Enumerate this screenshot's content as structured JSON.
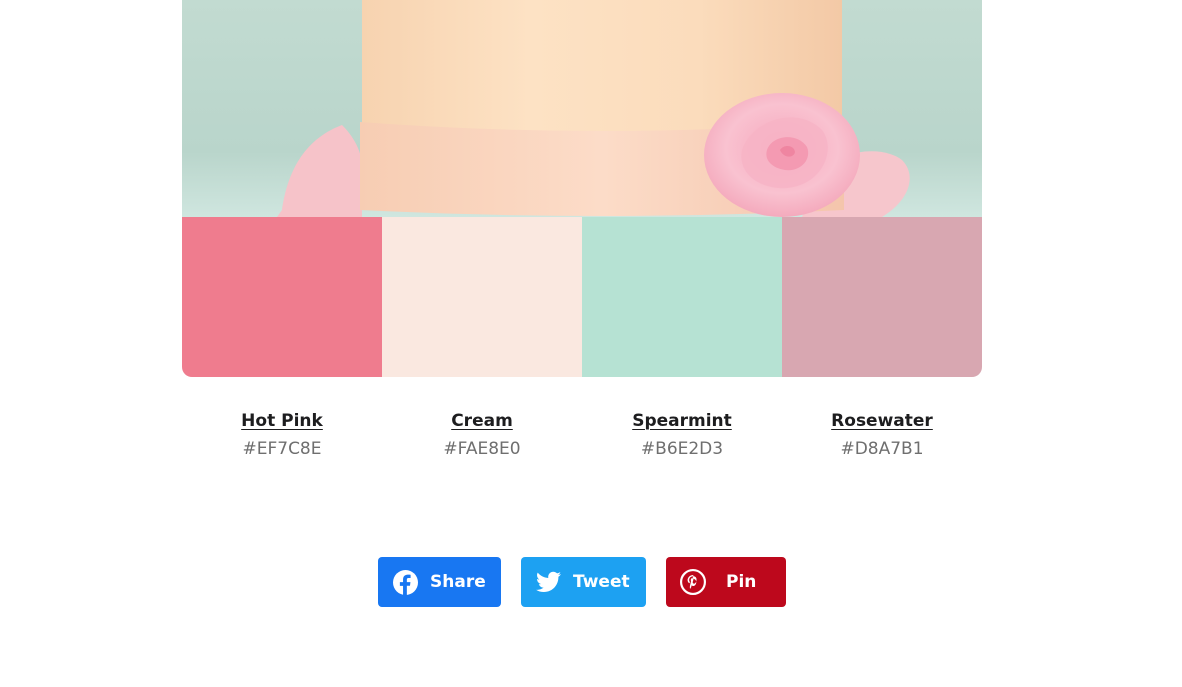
{
  "photo": {
    "subject": "peach cake with pink sugar rose"
  },
  "palette": [
    {
      "name": "Hot Pink",
      "hex": "#EF7C8E",
      "color": "#EF7C8E"
    },
    {
      "name": "Cream",
      "hex": "#FAE8E0",
      "color": "#FAE8E0"
    },
    {
      "name": "Spearmint",
      "hex": "#B6E2D3",
      "color": "#B6E2D3"
    },
    {
      "name": "Rosewater",
      "hex": "#D8A7B1",
      "color": "#D8A7B1"
    }
  ],
  "share": {
    "facebook": {
      "label": "Share",
      "icon": "facebook-icon",
      "color": "#1877F2"
    },
    "twitter": {
      "label": "Tweet",
      "icon": "twitter-icon",
      "color": "#1DA1F2"
    },
    "pinterest": {
      "label": "Pin",
      "icon": "pinterest-icon",
      "color": "#BD081C"
    }
  }
}
